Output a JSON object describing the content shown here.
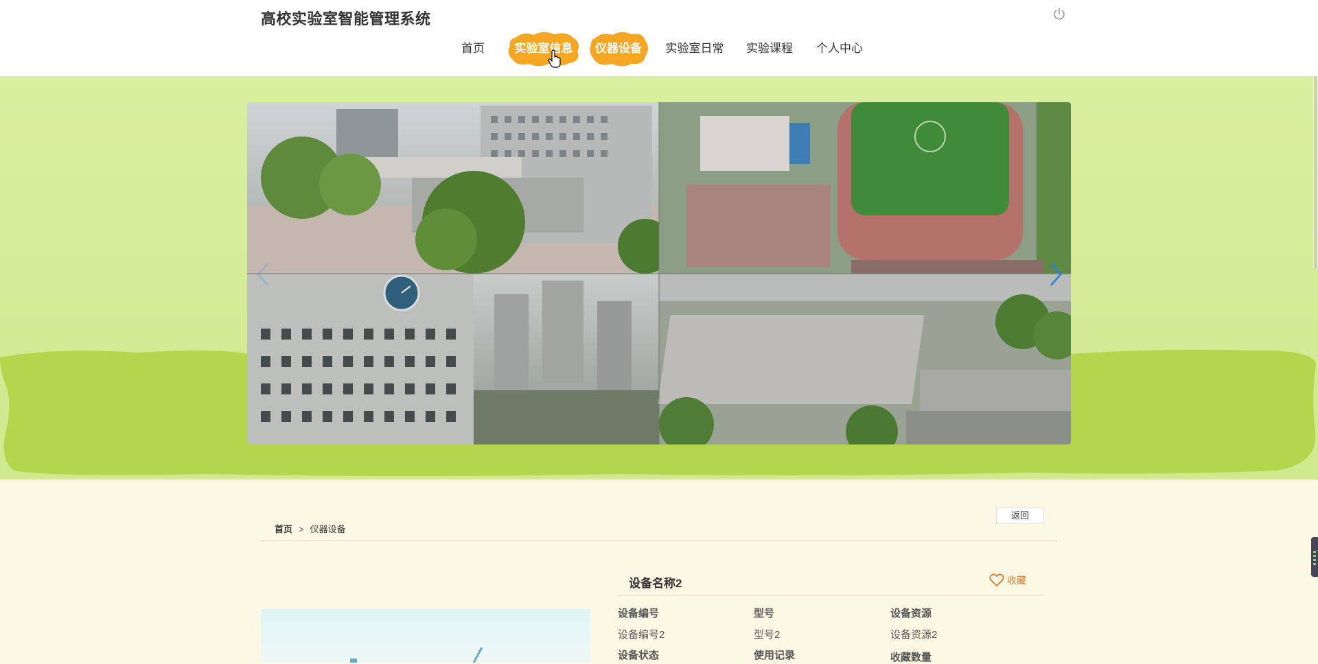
{
  "header": {
    "title": "高校实验室智能管理系统",
    "nav": [
      {
        "label": "首页",
        "active": false
      },
      {
        "label": "实验室信息",
        "active": true
      },
      {
        "label": "仪器设备",
        "active": true
      },
      {
        "label": "实验室日常",
        "active": false
      },
      {
        "label": "实验课程",
        "active": false
      },
      {
        "label": "个人中心",
        "active": false
      }
    ]
  },
  "colors": {
    "nav_active_bg": "#f5a623",
    "hero_bg": "#d9efa1",
    "hero_wave": "#b4d64c",
    "page_bg": "#fbf8e3",
    "favorite": "#e07b2c"
  },
  "content": {
    "back_label": "返回",
    "breadcrumb": {
      "home": "首页",
      "separator": ">",
      "current": "仪器设备"
    },
    "device_name": "设备名称2",
    "favorite_label": "收藏",
    "fields": [
      {
        "label": "设备编号",
        "value": "设备编号2"
      },
      {
        "label": "型号",
        "value": "型号2"
      },
      {
        "label": "设备资源",
        "value": "设备资源2"
      },
      {
        "label": "设备状态",
        "value": ""
      },
      {
        "label": "使用记录",
        "value": ""
      },
      {
        "label": "收藏数量",
        "value": ""
      }
    ]
  }
}
